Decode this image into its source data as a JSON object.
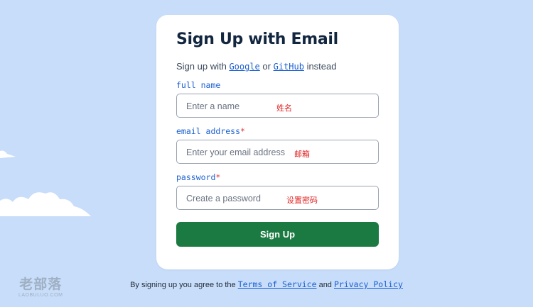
{
  "form": {
    "title": "Sign Up with Email",
    "subtitle_prefix": "Sign up with ",
    "google_link": "Google",
    "subtitle_or": " or ",
    "github_link": "GitHub",
    "subtitle_suffix": " instead",
    "fields": [
      {
        "label": "full name",
        "required": false,
        "placeholder": "Enter a name",
        "annotation": "姓名"
      },
      {
        "label": "email address",
        "required": true,
        "placeholder": "Enter your email address",
        "annotation": "邮箱"
      },
      {
        "label": "password",
        "required": true,
        "placeholder": "Create a password",
        "annotation": "设置密码"
      }
    ],
    "required_marker": "*",
    "submit_label": "Sign Up"
  },
  "footer": {
    "prefix": "By signing up you agree to the ",
    "terms_link": "Terms of Service",
    "and": " and ",
    "privacy_link": "Privacy Policy"
  },
  "watermark": {
    "main": "老部落",
    "sub": "LAOBULUO.COM"
  },
  "colors": {
    "background": "#c8ddf9",
    "accent_link": "#1a5fd0",
    "button": "#1b7a41",
    "required": "#e23b3b",
    "annotation": "#e02424"
  }
}
